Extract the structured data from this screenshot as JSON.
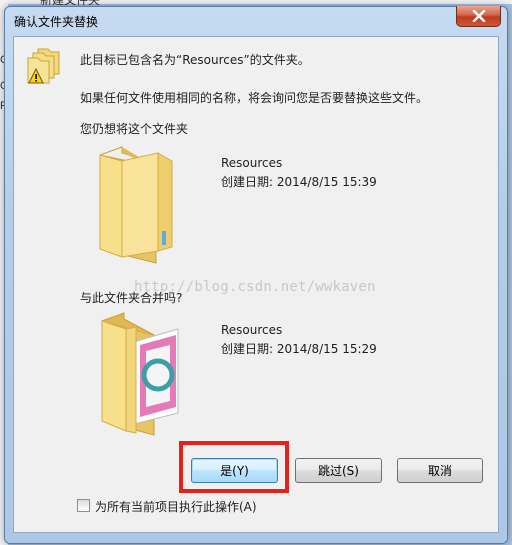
{
  "background": {
    "left_fragments": [
      "C",
      "O",
      "R"
    ],
    "top_fragment": "新建文件夹"
  },
  "dialog": {
    "title": "确认文件夹替换",
    "close_label": "×",
    "message": "此目标已包含名为“Resources”的文件夹。",
    "explanation": "如果任何文件使用相同的名称，将会询问您是否要替换这些文件。",
    "question1": "您仍想将这个文件夹",
    "question2": "与此文件夹合并吗?",
    "source_folder": {
      "name": "Resources",
      "created": "创建日期: 2014/8/15 15:39"
    },
    "target_folder": {
      "name": "Resources",
      "created": "创建日期: 2014/8/15 15:29"
    },
    "buttons": {
      "yes": "是(Y)",
      "skip": "跳过(S)",
      "cancel": "取消"
    },
    "checkbox_label": "为所有当前项目执行此操作(A)",
    "checkbox_checked": false
  },
  "watermark": "http://blog.csdn.net/wwkaven",
  "colors": {
    "highlight": "#e3231b",
    "close_button": "#c0391f",
    "folder": "#f2d271"
  }
}
